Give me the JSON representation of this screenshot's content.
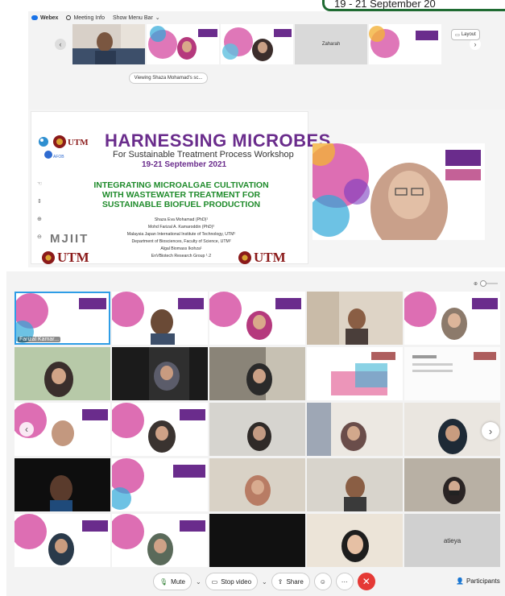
{
  "banner": {
    "text": "19 - 21 September 20"
  },
  "webex": {
    "menu": {
      "app": "Webex",
      "meeting_info": "Meeting Info",
      "show_menu_bar": "Show Menu Bar"
    },
    "zaharah": "Zaharah",
    "layout": "Layout",
    "viewing": "Viewing Shaza Mohamad's sc..."
  },
  "slide": {
    "title": "HARNESSING MICROBES",
    "subtitle": "For Sustainable Treatment Process Workshop",
    "date": "19-21 September 2021",
    "heading1": "INTEGRATING MICROALGAE CULTIVATION",
    "heading2": "WITH WASTEWATER TREATMENT FOR",
    "heading3": "SUSTAINABLE BIOFUEL PRODUCTION",
    "authors": [
      "Shaza Eva Mohamad (PhD)¹",
      "Mohd Farizal A. Kamaroddin (PhD)²",
      "Malaysia Japan International Institute of Technology, UTM¹",
      "Department of Biosciences, Faculty of Science, UTM²",
      "Algal Biomass Ikohza¹",
      "EnVBiotech Research Group ¹˒2"
    ],
    "mjiit": "MJIIT",
    "utm": "UTM",
    "afob": "AFOB"
  },
  "gallery": {
    "active_name": "Farizal Kamar...",
    "atieya": "atieya"
  },
  "controls": {
    "mute": "Mute",
    "stop_video": "Stop video",
    "share": "Share",
    "participants": "Participants"
  },
  "colors": {
    "purple": "#6a2c8c",
    "green": "#1f8b2b",
    "utm_red": "#8b1a1a",
    "end_red": "#e53935",
    "active_blue": "#2e9de6"
  }
}
